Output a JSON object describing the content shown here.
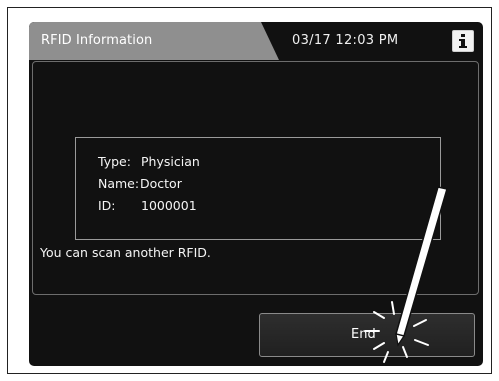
{
  "header": {
    "title": "RFID Information",
    "datetime": "03/17 12:03 PM",
    "info_glyph": "i",
    "info_icon": "info-icon"
  },
  "details": {
    "type_label": "Type:",
    "type_value": "Physician",
    "name_label": "Name:",
    "name_value": "Doctor",
    "id_label": "ID:",
    "id_value": "1000001"
  },
  "status_message": "You can scan another RFID.",
  "actions": {
    "end_label": "End",
    "pointer_icon": "stylus-tap-icon"
  },
  "colors": {
    "screen_bg": "#111111",
    "tab_bg": "#8f8f8f",
    "text": "#f5f5f5"
  }
}
